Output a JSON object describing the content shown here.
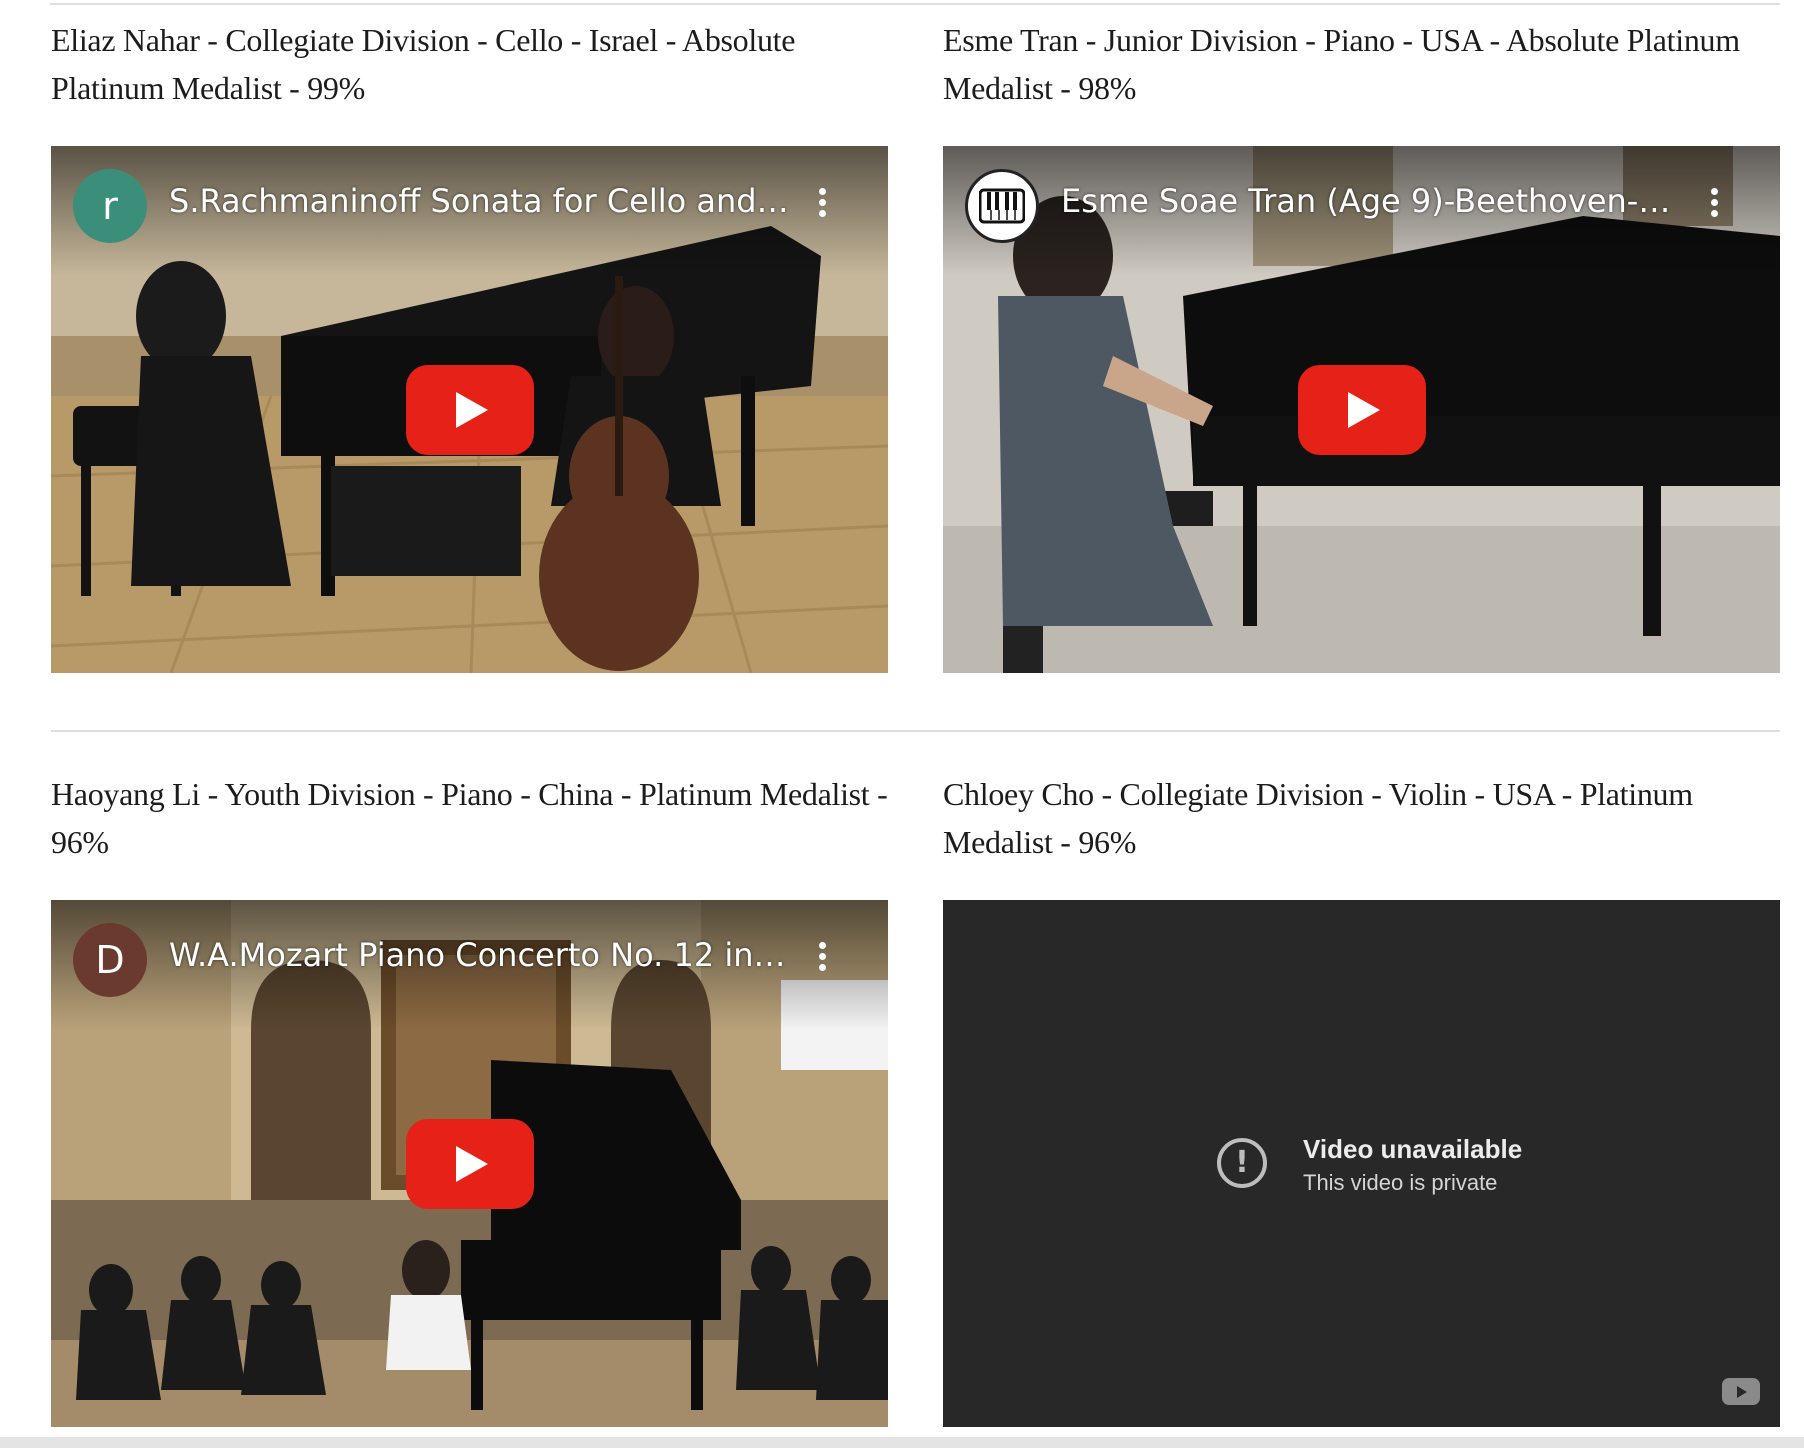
{
  "entries": [
    {
      "caption": "Eliaz Nahar - Collegiate Division - Cello - Israel - Absolute Platinum Medalist - 99%",
      "video": {
        "channel_initial": "r",
        "avatar_color": "#3b8f7a",
        "title": "S.Rachmaninoff Sonata for Cello and …",
        "state": "playable"
      }
    },
    {
      "caption": "Esme Tran - Junior Division - Piano - USA - Absolute Platinum Medalist - 98%",
      "video": {
        "channel_initial": "",
        "channel_icon": "piano-keys-icon",
        "title": "Esme Soae Tran (Age 9)-Beethoven-So…",
        "state": "playable"
      }
    },
    {
      "caption": "Haoyang Li - Youth Division - Piano - China - Platinum Medalist - 96%",
      "video": {
        "channel_initial": "D",
        "avatar_color": "#6b3a2e",
        "title": "W.A.Mozart Piano Concerto No. 12 in …",
        "state": "playable"
      }
    },
    {
      "caption": "Chloey Cho - Collegiate Division - Violin - USA - Platinum Medalist - 96%",
      "video": {
        "state": "unavailable",
        "message_title": "Video unavailable",
        "message_subtitle": "This video is private"
      }
    }
  ],
  "colors": {
    "play_button": "#e62117",
    "unavailable_bg": "#282828",
    "caption_text": "#1c1c1c"
  }
}
